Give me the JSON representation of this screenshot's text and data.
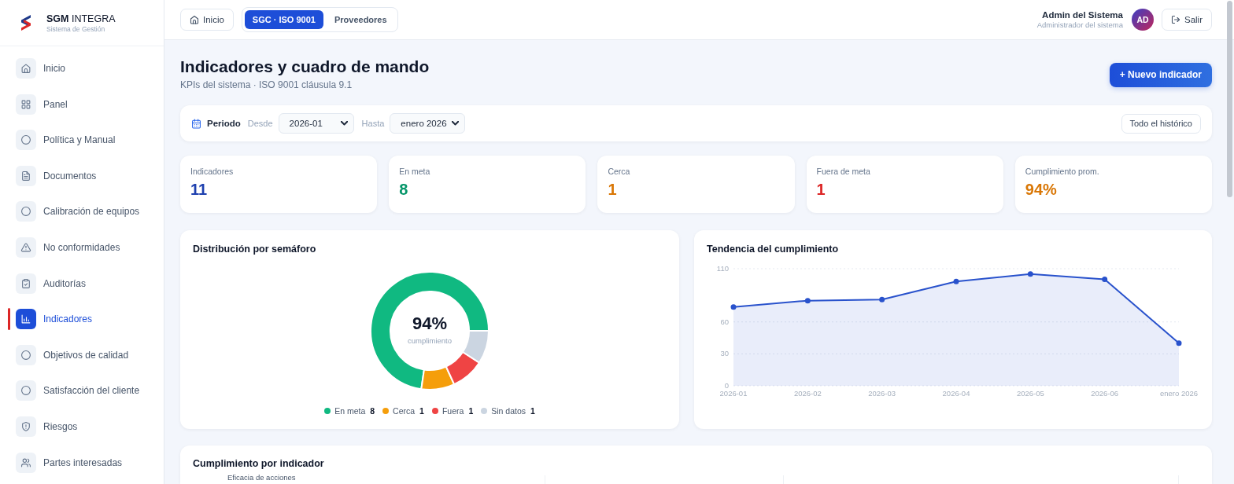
{
  "sidebar": {
    "brand": {
      "name": "**SGM** INTEGRA",
      "subtitle": "Sistema de Gestión"
    },
    "items": [
      {
        "label": "Inicio",
        "selected": false
      },
      {
        "label": "Panel",
        "selected": false
      },
      {
        "label": "Política y Manual",
        "selected": false
      },
      {
        "label": "Documentos",
        "selected": false
      },
      {
        "label": "Calibración de equipos",
        "selected": false
      },
      {
        "label": "No conformidades",
        "selected": false
      },
      {
        "label": "Auditorías",
        "selected": false
      },
      {
        "label": "Indicadores",
        "selected": true
      },
      {
        "label": "Objetivos de calidad",
        "selected": false
      },
      {
        "label": "Satisfacción del cliente",
        "selected": false
      },
      {
        "label": "Riesgos",
        "selected": false
      },
      {
        "label": "Partes interesadas",
        "selected": false
      }
    ]
  },
  "topbar": {
    "home_button": "Inicio",
    "tabs": [
      {
        "label": "SGC · ISO 9001",
        "selected": true
      },
      {
        "label": "Proveedores",
        "selected": false
      }
    ],
    "user": {
      "name": "Admin del Sistema",
      "role": "Administrador del sistema",
      "initials": "AD"
    },
    "logout_button": "Salir"
  },
  "header": {
    "title": "Indicadores y cuadro de mando",
    "subtitle": "KPIs del sistema · ISO 9001 cláusula 9.1",
    "new_button": "+ Nuevo indicador"
  },
  "period": {
    "label": "Periodo",
    "from_label": "Desde",
    "from_value": "2026-01",
    "to_label": "Hasta",
    "to_value": "enero 2026",
    "all_button": "Todo el histórico"
  },
  "kpis": [
    {
      "label": "Indicadores",
      "value": "11",
      "color": "#1e40af"
    },
    {
      "label": "En meta",
      "value": "8",
      "color": "#059669"
    },
    {
      "label": "Cerca",
      "value": "1",
      "color": "#d97706"
    },
    {
      "label": "Fuera de meta",
      "value": "1",
      "color": "#dc2626"
    },
    {
      "label": "Cumplimiento prom.",
      "value": "94%",
      "color": "#d97706"
    }
  ],
  "distribution": {
    "title": "Distribución por semáforo",
    "center_value": "94%",
    "center_label": "cumplimiento",
    "chart_data": {
      "type": "donut",
      "categories": [
        "En meta",
        "Cerca",
        "Fuera",
        "Sin datos"
      ],
      "values": [
        8,
        1,
        1,
        1
      ],
      "value_labels": [
        "8",
        "1",
        "1",
        "1"
      ],
      "legend": "bottom"
    },
    "slices": [
      {
        "color": "#10b981"
      },
      {
        "color": "#f59e0b"
      },
      {
        "color": "#ef4444"
      },
      {
        "color": "#cbd5e1"
      }
    ]
  },
  "trend": {
    "title": "Tendencia del cumplimiento",
    "chart_data": {
      "type": "area",
      "categories": [
        "2026-01",
        "2026-02",
        "2026-03",
        "2026-04",
        "2026-05",
        "2026-06",
        "enero 2026"
      ],
      "series": [
        {
          "color": "#2952cc",
          "values": [
            74,
            80,
            81,
            98,
            105,
            100,
            40
          ]
        }
      ],
      "ylim": [
        0,
        110
      ],
      "yticks": [
        0,
        30,
        60,
        110
      ]
    }
  },
  "compliance": {
    "title": "Cumplimiento por indicador",
    "rows": [
      {
        "label": "Eficacia de acciones"
      }
    ]
  }
}
